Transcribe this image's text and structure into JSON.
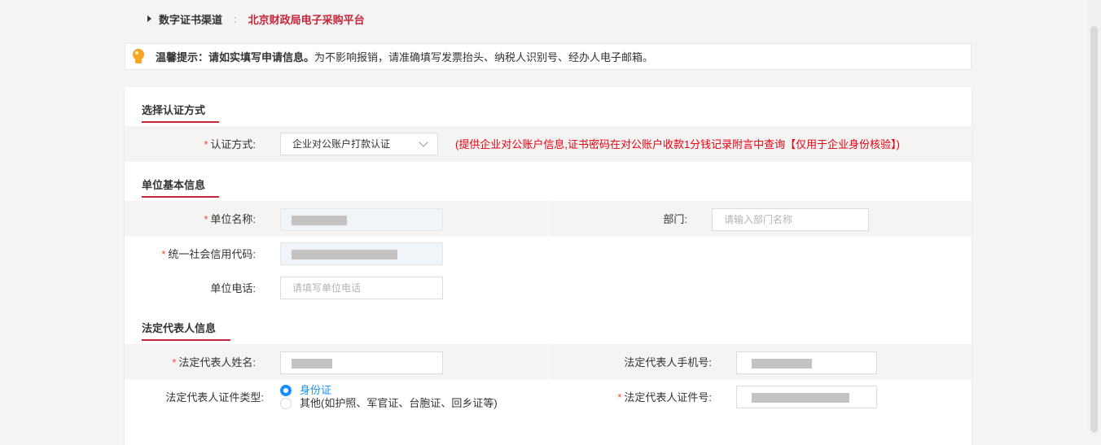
{
  "channel": {
    "label": "数字证书渠道",
    "separator": ":",
    "value": "北京财政局电子采购平台"
  },
  "tip": {
    "icon": "lightbulb-icon",
    "bold_text": "温馨提示：请如实填写申请信息。",
    "text": "为不影响报销，请准确填写发票抬头、纳税人识别号、经办人电子邮箱。"
  },
  "sections": {
    "auth": {
      "title": "选择认证方式",
      "method_label": "认证方式:",
      "method_value": "企业对公账户打款认证",
      "method_hint": "(提供企业对公账户信息,证书密码在对公账户收款1分钱记录附言中查询【仅用于企业身份核验】)"
    },
    "org": {
      "title": "单位基本信息",
      "name_label": "单位名称:",
      "dept_label": "部门:",
      "dept_placeholder": "请输入部门名称",
      "credit_label": "统一社会信用代码:",
      "phone_label": "单位电话:",
      "phone_placeholder": "请填写单位电话"
    },
    "legal": {
      "title": "法定代表人信息",
      "name_label": "法定代表人姓名:",
      "mobile_label": "法定代表人手机号:",
      "id_type_label": "法定代表人证件类型:",
      "id_type_options": [
        "身份证",
        "其他(如护照、军官证、台胞证、回乡证等)"
      ],
      "id_type_selected": "身份证",
      "id_number_label": "法定代表人证件号:"
    }
  },
  "required_mark": "*",
  "colors": {
    "accent": "#c5263a",
    "required": "#e84b3c",
    "hint": "#e60012",
    "radio": "#1890ff",
    "row_gray": "#f5f4f2"
  }
}
